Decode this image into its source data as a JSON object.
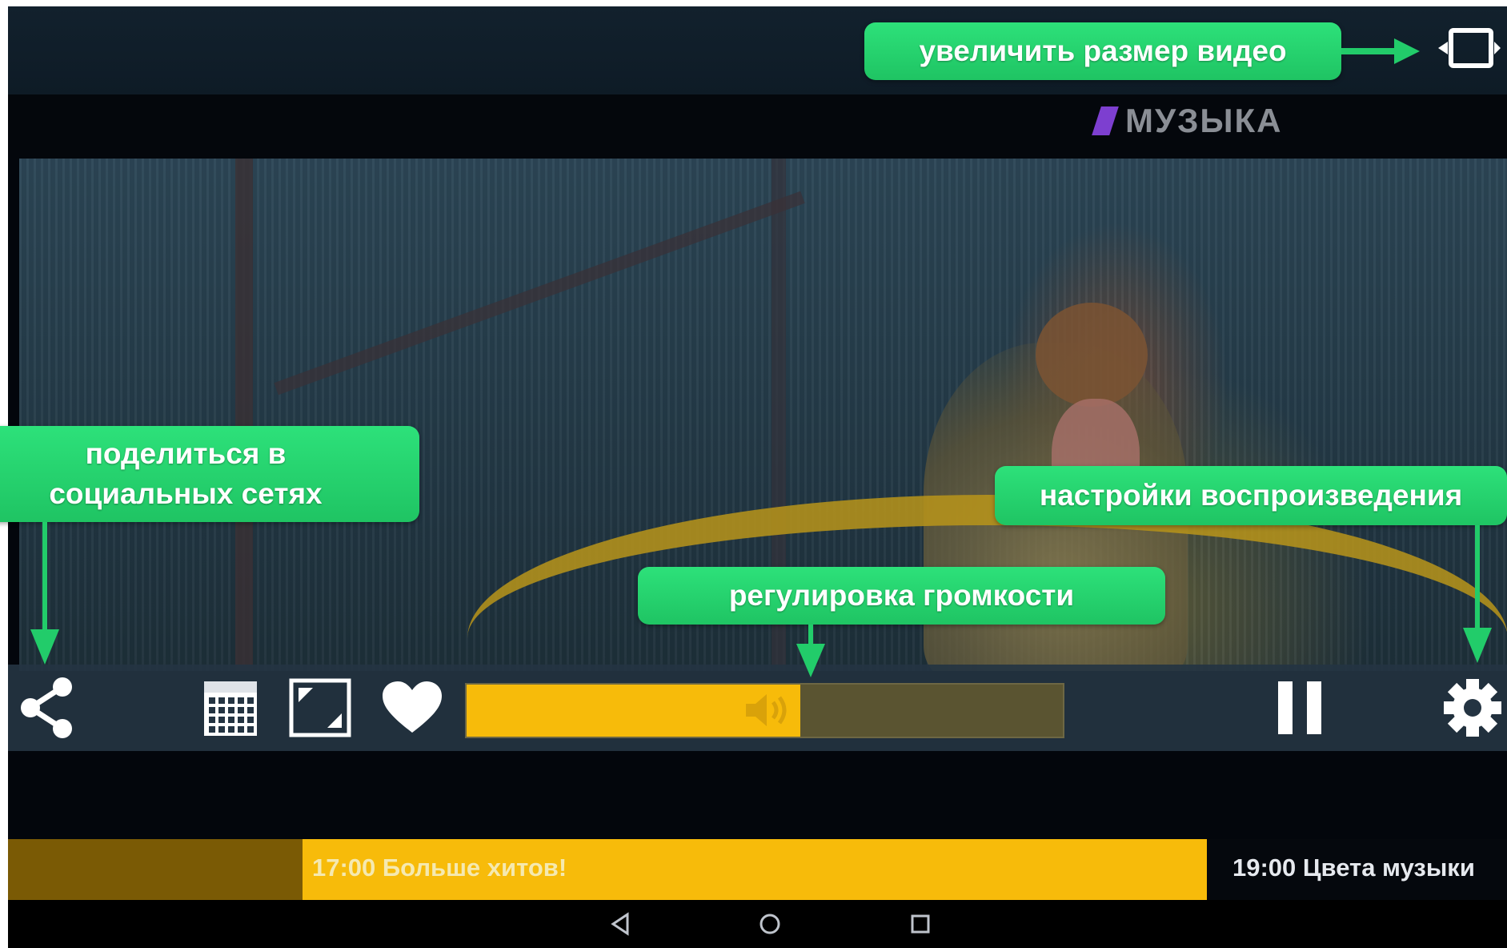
{
  "channel_logo": {
    "text": "МУЗЫКА",
    "mark_color": "#7d3fd0"
  },
  "annotations": {
    "expand_video": "увеличить размер видео",
    "share": "поделиться в социальных сетях",
    "playback_settings": "настройки воспроизведения",
    "volume": "регулировка громкости"
  },
  "controls": {
    "share_icon": "share-icon",
    "schedule_icon": "calendar-icon",
    "fit_icon": "resize-icon",
    "favorite_icon": "heart-icon",
    "pause_icon": "pause-icon",
    "settings_icon": "gear-icon",
    "expand_icon": "expand-icon",
    "volume_level": 0.56
  },
  "schedule": {
    "current": "17:00 Больше хитов!",
    "next": "19:00 Цвета музыки"
  },
  "colors": {
    "accent": "#f7bb0a",
    "callout": "#22cc6a",
    "controlbar": "#243442"
  }
}
